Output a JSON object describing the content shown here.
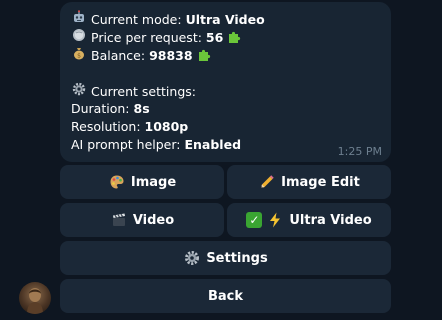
{
  "message": {
    "mode_emoji": "robot-icon",
    "mode_label": "Current mode:",
    "mode_value": "Ultra Video",
    "price_emoji": "coin-icon",
    "price_label": "Price per request:",
    "price_value": "56",
    "balance_emoji": "money-bag-icon",
    "balance_label": "Balance:",
    "balance_value": "98838",
    "settings_header": "Current settings:",
    "duration_label": "Duration:",
    "duration_value": "8s",
    "resolution_label": "Resolution:",
    "resolution_value": "1080p",
    "helper_label": "AI prompt helper:",
    "helper_value": "Enabled",
    "time": "1:25 PM"
  },
  "keyboard": {
    "image_label": "Image",
    "image_edit_label": "Image Edit",
    "video_label": "Video",
    "ultra_video_label": "Ultra Video",
    "settings_label": "Settings",
    "back_label": "Back"
  },
  "colors": {
    "background": "#0e1621",
    "bubble": "#182533",
    "button": "#1b2837",
    "puzzle_green": "#6bc63a"
  }
}
